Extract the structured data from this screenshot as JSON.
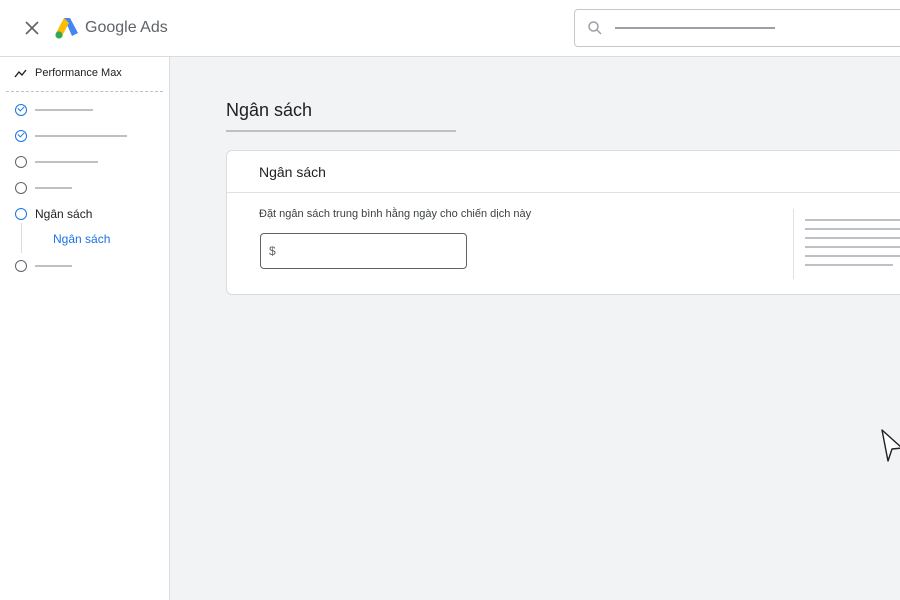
{
  "header": {
    "brand": "Google Ads",
    "icons": {
      "close": "close-icon",
      "logo": "google-ads-logo",
      "search": "search-icon"
    }
  },
  "sidebar": {
    "campaign_type": "Performance Max",
    "campaign_type_icon": "trending-icon",
    "steps": [
      {
        "state": "completed",
        "label": ""
      },
      {
        "state": "completed",
        "label": ""
      },
      {
        "state": "pending",
        "label": ""
      },
      {
        "state": "pending",
        "label": ""
      },
      {
        "state": "active",
        "label": "Ngân sách"
      },
      {
        "state": "pending",
        "label": ""
      }
    ],
    "sub_step": "Ngân sách"
  },
  "main": {
    "page_title": "Ngân sách",
    "card": {
      "title": "Ngân sách",
      "description": "Đặt ngân sách trung bình hằng ngày cho chiến dịch này",
      "input_prefix": "$",
      "input_value": ""
    }
  },
  "colors": {
    "accent": "#1a73e8",
    "background": "#f1f3f4",
    "surface": "#ffffff",
    "placeholder_line": "#bdc1c6"
  }
}
